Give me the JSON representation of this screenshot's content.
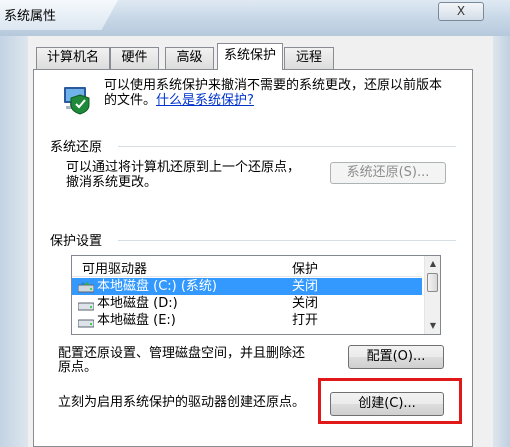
{
  "window": {
    "title": "系统属性",
    "close_glyph": "X"
  },
  "tabs": [
    "计算机名",
    "硬件",
    "高级",
    "系统保护",
    "远程"
  ],
  "active_tab": 3,
  "info": {
    "text": "可以使用系统保护来撤消不需要的系统更改，还原以前版本的文件。",
    "link": "什么是系统保护?"
  },
  "restore": {
    "group_label": "系统还原",
    "desc_line1": "可以通过将计算机还原到上一个还原点，",
    "desc_line2": "撤消系统更改。",
    "button_label": "系统还原(S)..."
  },
  "protection": {
    "group_label": "保护设置",
    "columns": [
      "可用驱动器",
      "保护"
    ],
    "drives": [
      {
        "name": "本地磁盘 (C:) (系统)",
        "protection": "关闭",
        "selected": true,
        "icon": "system-drive-icon"
      },
      {
        "name": "本地磁盘 (D:)",
        "protection": "关闭",
        "selected": false,
        "icon": "drive-icon"
      },
      {
        "name": "本地磁盘 (E:)",
        "protection": "打开",
        "selected": false,
        "icon": "drive-icon"
      }
    ],
    "configure_text_line1": "配置还原设置、管理磁盘空间，并且删除还",
    "configure_text_line2": "原点。",
    "configure_button": "配置(O)...",
    "create_text": "立刻为启用系统保护的驱动器创建还原点。",
    "create_button": "创建(C)..."
  },
  "colors": {
    "selection": "#3399ff",
    "highlight_box": "#e01818",
    "link": "#0033cc"
  }
}
